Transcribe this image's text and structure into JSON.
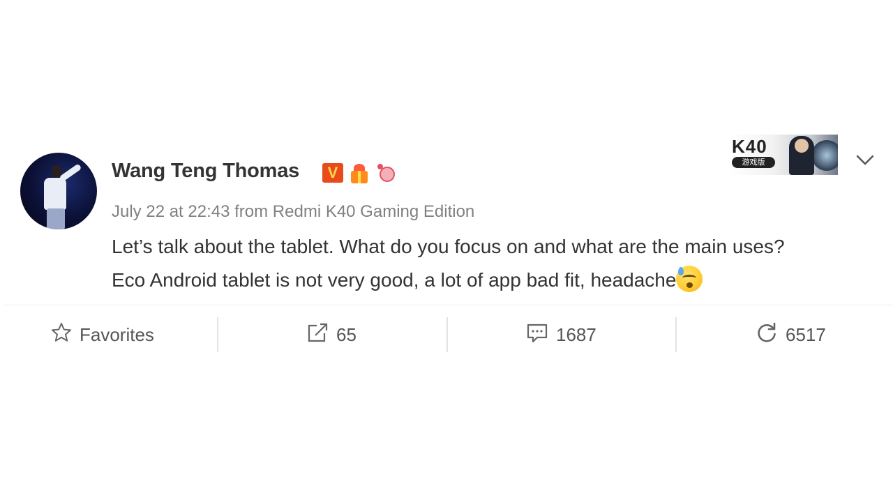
{
  "post": {
    "author": "Wang Teng Thomas",
    "verified_badge": "V",
    "timestamp": "July 22 at 22:43",
    "source": "from Redmi K40 Gaming Edition",
    "text_line_1": "Let’s talk about the tablet. What do you focus on and what are the main uses?",
    "text_line_2": "Eco Android tablet is not very good, a lot of app bad fit, headache",
    "emoji": "tired-face-emoji"
  },
  "banner": {
    "title": "K40",
    "subtitle": "游戏版"
  },
  "actions": {
    "favorites_label": "Favorites",
    "forward_count": "65",
    "comment_count": "1687",
    "like_count": "6517"
  },
  "icons": {
    "favorites": "star-icon",
    "forward": "share-icon",
    "comment": "comment-icon",
    "like": "refresh-like-icon",
    "menu": "chevron-down-icon"
  },
  "colors": {
    "text": "#333333",
    "meta": "#808080",
    "verified": "#e84a1c"
  }
}
